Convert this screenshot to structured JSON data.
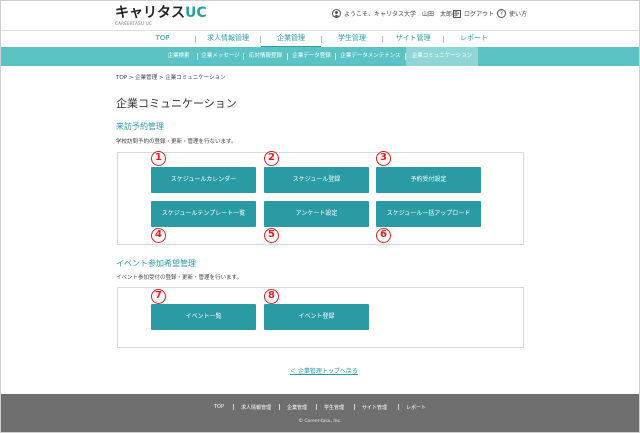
{
  "header": {
    "logo_main": "キャリタス",
    "logo_uc": "UC",
    "logo_sub": "CAREERTASU UC",
    "greeting": "ようこそ、キャリタス大学",
    "user_last": "山田",
    "user_first": "太郎様",
    "logout": "ログアウト",
    "help": "使い方"
  },
  "main_nav": [
    {
      "label": "TOP"
    },
    {
      "label": "求人情報管理"
    },
    {
      "label": "企業管理"
    },
    {
      "label": "学生管理"
    },
    {
      "label": "サイト管理"
    },
    {
      "label": "レポート"
    }
  ],
  "sub_nav": [
    {
      "label": "企業検索"
    },
    {
      "label": "企業メッセージ"
    },
    {
      "label": "応対情報登録"
    },
    {
      "label": "企業データ登録"
    },
    {
      "label": "企業データメンテナンス"
    },
    {
      "label": "企業コミュニケーション"
    }
  ],
  "breadcrumb": "TOP > 企業管理 > 企業コミュニケーション",
  "page_title": "企業コミュニケーション",
  "section1": {
    "title": "来訪予約管理",
    "desc": "学校訪問予約の登録・更新・管理を行ないます。",
    "buttons": [
      {
        "label": "スケジュールカレンダー",
        "marker": "1"
      },
      {
        "label": "スケジュール登録",
        "marker": "2"
      },
      {
        "label": "予約受付設定",
        "marker": "3"
      },
      {
        "label": "スケジュールテンプレート一覧",
        "marker": "4"
      },
      {
        "label": "アンケート設定",
        "marker": "5"
      },
      {
        "label": "スケジュール一括アップロード",
        "marker": "6"
      }
    ]
  },
  "section2": {
    "title": "イベント参加希望管理",
    "desc": "イベント参加受付の登録・更新・管理を行います。",
    "buttons": [
      {
        "label": "イベント一覧",
        "marker": "7"
      },
      {
        "label": "イベント登録",
        "marker": "8"
      }
    ]
  },
  "back_link": "＜ 企業管理トップへ戻る",
  "footer": {
    "links": [
      {
        "label": "TOP"
      },
      {
        "label": "求人情報管理"
      },
      {
        "label": "企業管理"
      },
      {
        "label": "学生管理"
      },
      {
        "label": "サイト管理"
      },
      {
        "label": "レポート"
      }
    ],
    "copyright": "© Career-tasu, Inc."
  },
  "colors": {
    "accent": "#2a9ba4",
    "subnav": "#5cc3c5",
    "marker": "#e02020",
    "footer": "#6f6f6f"
  }
}
